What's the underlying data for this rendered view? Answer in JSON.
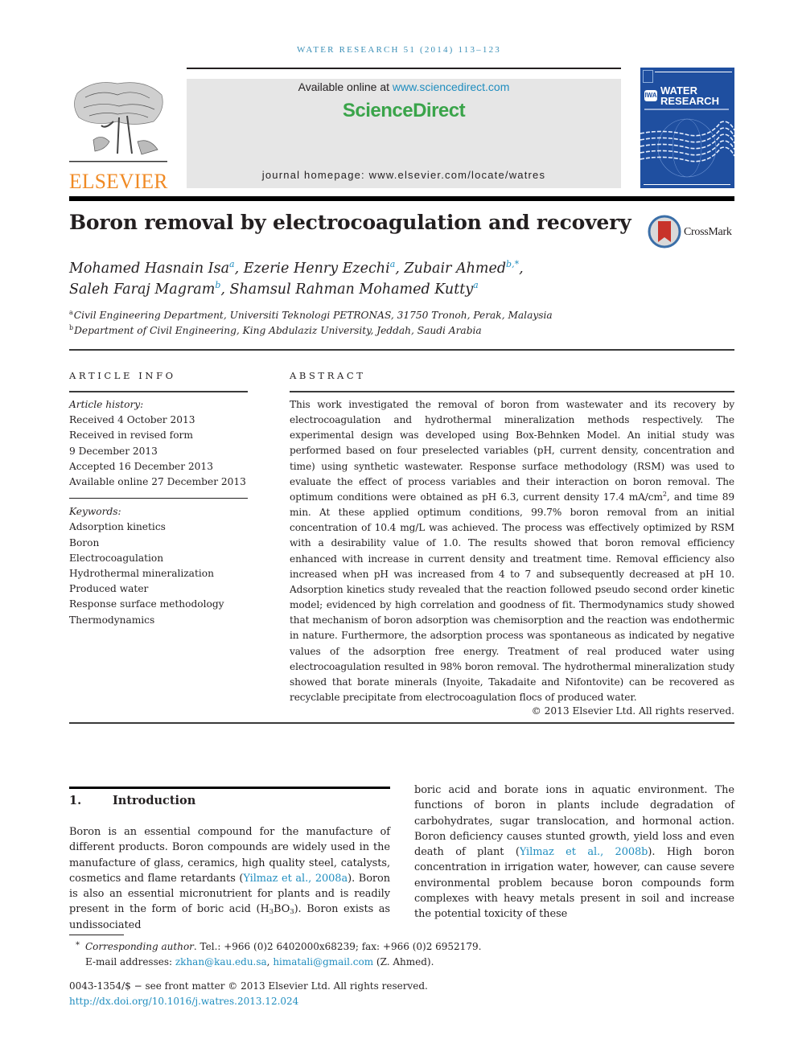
{
  "journal": {
    "running_head": "WATER RESEARCH 51 (2014) 113–123",
    "publisher_logo_text": "ELSEVIER",
    "available_online_prefix": "Available online at ",
    "available_online_link": "www.sciencedirect.com",
    "platform_brand": "ScienceDirect",
    "homepage_text": "journal homepage: www.elsevier.com/locate/watres",
    "cover": {
      "badge": "IWA",
      "title_line1": "WATER",
      "title_line2": "RESEARCH"
    },
    "crossmark_label": "CrossMark"
  },
  "colors": {
    "link": "#1f8dbf",
    "elsevier_orange": "#f08a24",
    "sciencedirect_green": "#3aa44a",
    "cover_blue": "#1f4fa0",
    "header_box_gray": "#e6e6e6"
  },
  "article": {
    "title": "Boron removal by electrocoagulation and recovery",
    "authors": [
      {
        "name": "Mohamed Hasnain Isa",
        "affil": "a",
        "sep": ", "
      },
      {
        "name": "Ezerie Henry Ezechi",
        "affil": "a",
        "sep": ", "
      },
      {
        "name": "Zubair Ahmed",
        "affil": "b,*",
        "sep": ","
      },
      {
        "name": "Saleh Faraj Magram",
        "affil": "b",
        "sep": ", "
      },
      {
        "name": "Shamsul Rahman Mohamed Kutty",
        "affil": "a",
        "sep": ""
      }
    ],
    "affiliations": [
      {
        "key": "a",
        "text": "Civil Engineering Department, Universiti Teknologi PETRONAS, 31750 Tronoh, Perak, Malaysia"
      },
      {
        "key": "b",
        "text": "Department of Civil Engineering, King Abdulaziz University, Jeddah, Saudi Arabia"
      }
    ]
  },
  "article_info": {
    "heading": "ARTICLE INFO",
    "history_label": "Article history:",
    "history": [
      "Received 4 October 2013",
      "Received in revised form",
      "9 December 2013",
      "Accepted 16 December 2013",
      "Available online 27 December 2013"
    ],
    "keywords_label": "Keywords:",
    "keywords": [
      "Adsorption kinetics",
      "Boron",
      "Electrocoagulation",
      "Hydrothermal mineralization",
      "Produced water",
      "Response surface methodology",
      "Thermodynamics"
    ]
  },
  "abstract": {
    "heading": "ABSTRACT",
    "text_part1": "This work investigated the removal of boron from wastewater and its recovery by electrocoagulation and hydrothermal mineralization methods respectively. The experimental design was developed using Box-Behnken Model. An initial study was performed based on four preselected variables (pH, current density, concentration and time) using synthetic wastewater. Response surface methodology (RSM) was used to evaluate the effect of process variables and their interaction on boron removal. The optimum conditions were obtained as pH 6.3, current density 17.4 mA/cm",
    "text_sup": "2",
    "text_part2": ", and time 89 min. At these applied optimum conditions, 99.7% boron removal from an initial concentration of 10.4 mg/L was achieved. The process was effectively optimized by RSM with a desirability value of 1.0. The results showed that boron removal efficiency enhanced with increase in current density and treatment time. Removal efficiency also increased when pH was increased from 4 to 7 and subsequently decreased at pH 10. Adsorption kinetics study revealed that the reaction followed pseudo second order kinetic model; evidenced by high correlation and goodness of fit. Thermodynamics study showed that mechanism of boron adsorption was chemisorption and the reaction was endothermic in nature. Furthermore, the adsorption process was spontaneous as indicated by negative values of the adsorption free energy. Treatment of real produced water using electrocoagulation resulted in 98% boron removal. The hydrothermal mineralization study showed that borate minerals (Inyoite, Takadaite and Nifontovite) can be recovered as recyclable precipitate from electrocoagulation flocs of produced water.",
    "copyright": "© 2013 Elsevier Ltd. All rights reserved."
  },
  "introduction": {
    "number": "1.",
    "heading": "Introduction",
    "left": {
      "p1": "Boron is an essential compound for the manufacture of different products. Boron compounds are widely used in the manufacture of glass, ceramics, high quality steel, catalysts, cosmetics and flame retardants (",
      "cite1": "Yilmaz et al., 2008a",
      "p2": "). Boron is also an essential micronutrient for plants and is readily present in the form of boric acid (H",
      "sub1": "3",
      "p3": "BO",
      "sub2": "3",
      "p4": "). Boron exists as undissociated"
    },
    "right": {
      "p1": "boric acid and borate ions in aquatic environment. The functions of boron in plants include degradation of carbohydrates, sugar translocation, and hormonal action. Boron deficiency causes stunted growth, yield loss and even death of plant (",
      "cite1": "Yilmaz et al., 2008b",
      "p2": "). High boron concentration in irrigation water, however, can cause severe environmental problem because boron compounds form complexes with heavy metals present in soil and increase the potential toxicity of these"
    }
  },
  "footnote": {
    "star": "*",
    "label": "Corresponding author",
    "contact": ". Tel.: +966 (0)2 6402000x68239; fax: +966 (0)2 6952179.",
    "email_label": "E-mail addresses: ",
    "email1": "zkhan@kau.edu.sa",
    "email_sep": ", ",
    "email2": "himatali@gmail.com",
    "email_suffix": " (Z. Ahmed)."
  },
  "front_matter": {
    "issn_line": "0043-1354/$ − see front matter © 2013 Elsevier Ltd. All rights reserved.",
    "doi": "http://dx.doi.org/10.1016/j.watres.2013.12.024"
  }
}
